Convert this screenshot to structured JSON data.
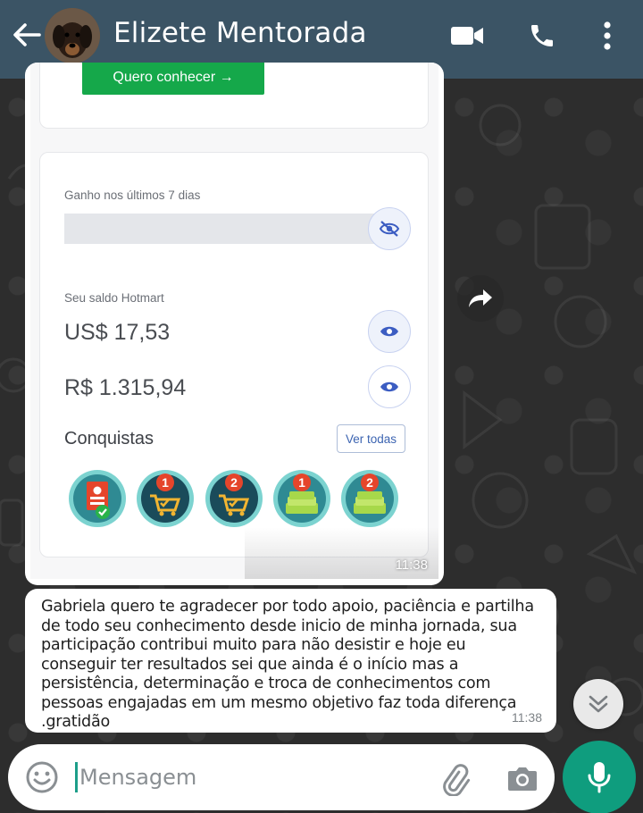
{
  "header": {
    "contact_name": "Elizete Mentorada",
    "icons": [
      "back-arrow-icon",
      "video-call-icon",
      "voice-call-icon",
      "more-vert-icon"
    ],
    "bar_color": "#3b5465"
  },
  "image_message": {
    "cta_label": "Quero conhecer →",
    "earnings_label": "Ganho nos últimos 7 dias",
    "balance_label": "Seu saldo Hotmart",
    "balance_usd": "US$ 17,53",
    "balance_brl": "R$ 1.315,94",
    "achievements_title": "Conquistas",
    "see_all_label": "Ver todas",
    "badge_numbers": [
      "1",
      "2",
      "1",
      "2"
    ],
    "time": "11:38"
  },
  "text_message": {
    "text": "Gabriela quero te agradecer por todo apoio, paciência e partilha de todo seu conhecimento desde inicio de minha jornada, sua participação contribui muito para não desistir e hoje eu conseguir ter resultados sei que ainda é o início mas a persistência, determinação e troca de conhecimentos com pessoas engajadas em um mesmo objetivo faz toda diferença .gratidão",
    "time": "11:38"
  },
  "composer": {
    "placeholder": "Mensagem",
    "accent_color": "#0f9d7e"
  }
}
